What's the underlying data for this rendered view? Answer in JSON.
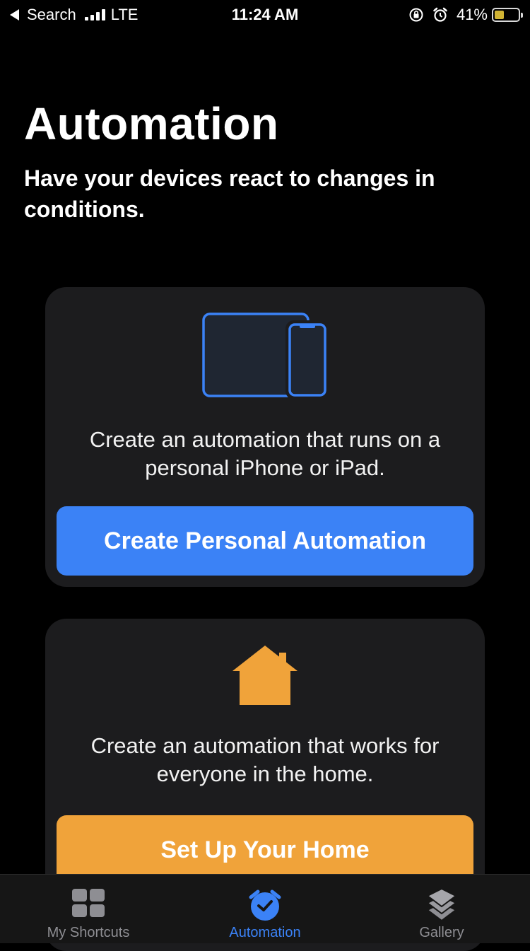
{
  "status_bar": {
    "back_label": "Search",
    "network": "LTE",
    "time": "11:24 AM",
    "battery_percent": "41%",
    "battery_level": 0.41,
    "icons": [
      "signal-icon",
      "orientation-lock-icon",
      "alarm-icon",
      "battery-icon"
    ]
  },
  "header": {
    "title": "Automation",
    "subtitle": "Have your devices react to changes in conditions."
  },
  "cards": {
    "personal": {
      "icon": "devices-icon",
      "description": "Create an automation that runs on a personal iPhone or iPad.",
      "button_label": "Create Personal Automation"
    },
    "home": {
      "icon": "house-icon",
      "description": "Create an automation that works for everyone in the home.",
      "button_label": "Set Up Your Home"
    }
  },
  "tab_bar": {
    "tabs": [
      {
        "label": "My Shortcuts",
        "icon": "grid-icon",
        "selected": false
      },
      {
        "label": "Automation",
        "icon": "clock-check-icon",
        "selected": true
      },
      {
        "label": "Gallery",
        "icon": "layers-icon",
        "selected": false
      }
    ]
  },
  "colors": {
    "background": "#000000",
    "card": "#1c1c1e",
    "accent_blue": "#3b82f6",
    "accent_orange": "#f0a33a",
    "tab_inactive": "#8e8e93",
    "battery_fill": "#f5d33c"
  }
}
